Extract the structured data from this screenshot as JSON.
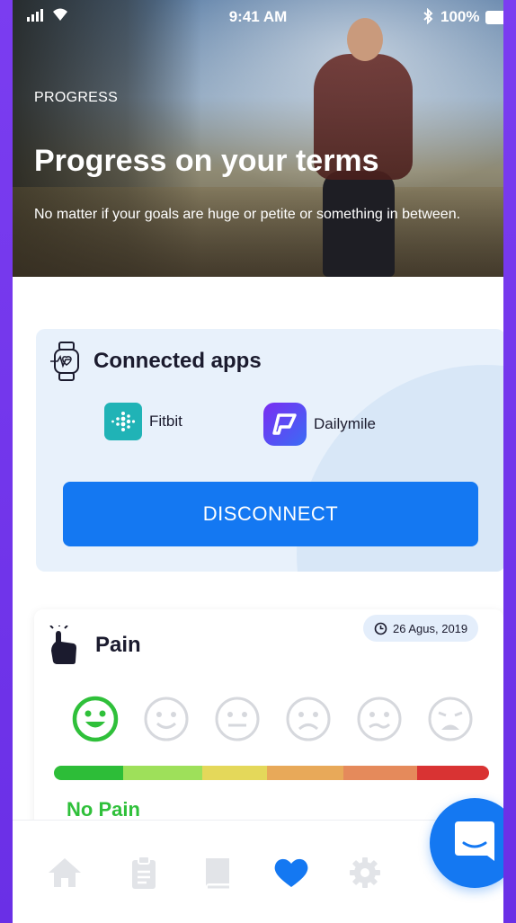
{
  "status_bar": {
    "time": "9:41 AM",
    "battery": "100%",
    "icons": [
      "signal-icon",
      "wifi-icon",
      "bluetooth-icon",
      "battery-icon"
    ]
  },
  "hero": {
    "eyebrow": "PROGRESS",
    "title": "Progress on your terms",
    "subtitle": "No matter if your goals are huge or petite or something in between."
  },
  "connected_apps": {
    "title": "Connected apps",
    "apps": [
      {
        "name": "Fitbit",
        "icon": "fitbit-logo"
      },
      {
        "name": "Dailymile",
        "icon": "dailymile-logo"
      }
    ],
    "button_label": "DISCONNECT"
  },
  "pain": {
    "title": "Pain",
    "date": "26 Agus, 2019",
    "faces": [
      "very-happy",
      "happy",
      "neutral",
      "sad",
      "worried",
      "very-sad"
    ],
    "selected_face_index": 0,
    "status_label": "No Pain",
    "scale_colors": [
      "#2dbd38",
      "#9ee05a",
      "#e4d85a",
      "#e8a959",
      "#e58a5b",
      "#d93333"
    ]
  },
  "bottom_nav": {
    "items": [
      "home-icon",
      "clipboard-icon",
      "book-icon",
      "heart-icon",
      "gear-icon"
    ],
    "active_index": 3
  },
  "colors": {
    "primary": "#1478f2",
    "pain_ok": "#2fc03a",
    "background": "#7b3df0"
  }
}
